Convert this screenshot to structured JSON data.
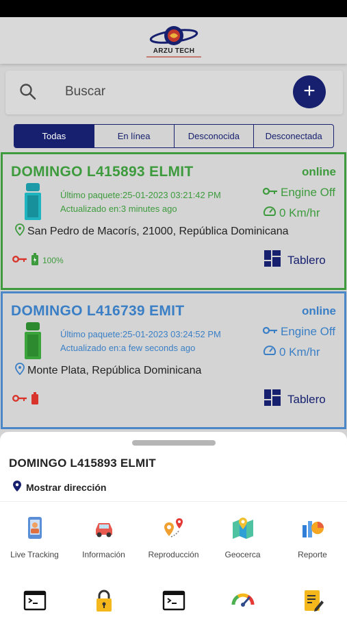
{
  "header": {
    "logo_text": "ARZU TECH"
  },
  "search": {
    "placeholder": "Buscar",
    "add_label": "+"
  },
  "filters": [
    {
      "label": "Todas",
      "active": true
    },
    {
      "label": "En línea",
      "active": false
    },
    {
      "label": "Desconocida",
      "active": false
    },
    {
      "label": "Desconectada",
      "active": false
    }
  ],
  "vehicles": [
    {
      "name": "DOMINGO L415893 ELMIT",
      "status": "online",
      "last_packet": "Último paquete:25-01-2023 03:21:42 PM",
      "updated": "Actualizado en:3 minutes ago",
      "engine": "Engine Off",
      "speed": "0 Km/hr",
      "address": "San Pedro de Macorís, 21000, República Dominicana",
      "battery": "100%",
      "dashboard_label": "Tablero",
      "accent": "#3d9b3d"
    },
    {
      "name": "DOMINGO L416739 EMIT",
      "status": "online",
      "last_packet": "Último paquete:25-01-2023 03:24:52 PM",
      "updated": "Actualizado en:a few seconds ago",
      "engine": "Engine Off",
      "speed": "0 Km/hr",
      "address": "Monte Plata, República Dominicana",
      "battery": "",
      "dashboard_label": "Tablero",
      "accent": "#3a7fc6"
    }
  ],
  "sheet": {
    "title": "DOMINGO L415893 ELMIT",
    "show_address": "Mostrar dirección",
    "actions": [
      {
        "label": "Live Tracking",
        "icon": "live-tracking-icon"
      },
      {
        "label": "Información",
        "icon": "car-icon"
      },
      {
        "label": "Reproducción",
        "icon": "route-pins-icon"
      },
      {
        "label": "Geocerca",
        "icon": "map-icon"
      },
      {
        "label": "Reporte",
        "icon": "report-chart-icon"
      },
      {
        "label": "",
        "icon": "terminal-icon"
      },
      {
        "label": "",
        "icon": "lock-icon"
      },
      {
        "label": "",
        "icon": "terminal-icon"
      },
      {
        "label": "",
        "icon": "speedometer-icon"
      },
      {
        "label": "",
        "icon": "notes-icon"
      }
    ]
  },
  "colors": {
    "primary": "#16206e",
    "online_green": "#3d9b3d",
    "online_blue": "#3a7fc6",
    "alert_red": "#d9342b"
  }
}
